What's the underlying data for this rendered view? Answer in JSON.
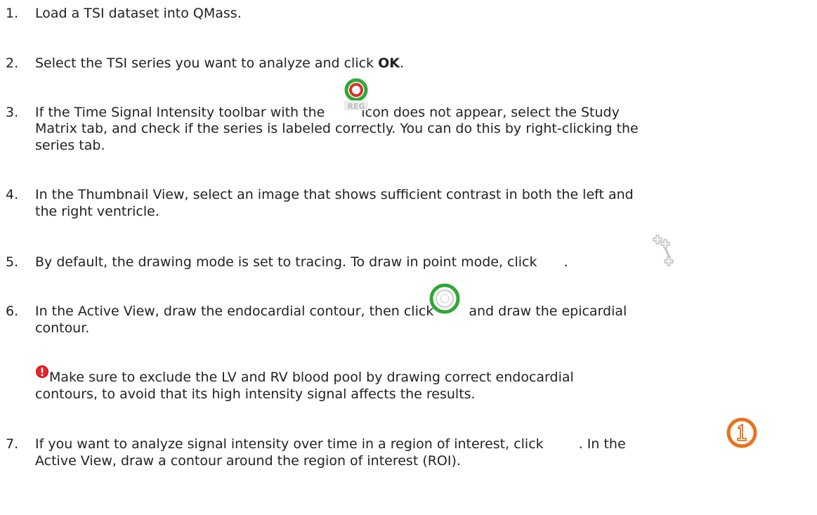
{
  "steps": [
    {
      "num": "1.",
      "text": "Load a TSI dataset into QMass."
    },
    {
      "num": "2.",
      "pre": "Select the TSI series you want to analyze and click ",
      "bold": "OK",
      "post": "."
    },
    {
      "num": "3.",
      "pre": "If the Time Signal Intensity toolbar with the ",
      "icon": "reg-toolbar-icon",
      "icon_text": "REG",
      "post": " icon does not appear, select the Study",
      "line2": "Matrix tab, and check if the series is labeled correctly. You can do this by right-clicking the",
      "line3": "series tab."
    },
    {
      "num": "4.",
      "line1": "In the Thumbnail View, select an image that shows sufficient contrast in both the left and",
      "line2": "the right ventricle."
    },
    {
      "num": "5.",
      "pre": "By default, the drawing mode is set to tracing. To draw in point mode, click ",
      "icon": "point-mode-icon",
      "post": "."
    },
    {
      "num": "6.",
      "pre": "In the Active View, draw the endocardial contour, then click ",
      "icon": "epicardial-contour-icon",
      "post": "and draw the epicardial",
      "line2": "contour."
    },
    {
      "num": "7.",
      "pre": "If you want to analyze signal intensity over time in a region of interest, click ",
      "icon": "roi-1-icon",
      "post": ". In the",
      "line2": "Active View, draw a contour around the region of interest (ROI)."
    }
  ],
  "note": {
    "icon": "warning-icon",
    "line1": " Make sure to exclude the LV and RV blood pool by drawing correct endocardial",
    "line2": "contours, to avoid that its high intensity signal affects the results."
  },
  "colors": {
    "text": "#222222",
    "warning": "#d9141a",
    "ring_green": "#2fa836",
    "ring_red": "#d8312a",
    "roi_orange": "#e8731c"
  }
}
